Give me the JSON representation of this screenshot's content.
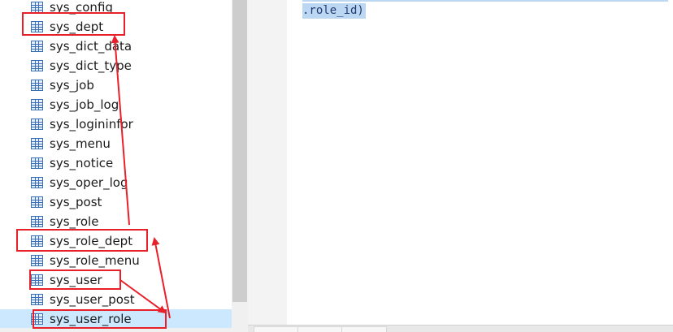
{
  "tables": [
    {
      "name": "sys_config"
    },
    {
      "name": "sys_dept"
    },
    {
      "name": "sys_dict_data"
    },
    {
      "name": "sys_dict_type"
    },
    {
      "name": "sys_job"
    },
    {
      "name": "sys_job_log"
    },
    {
      "name": "sys_logininfor"
    },
    {
      "name": "sys_menu"
    },
    {
      "name": "sys_notice"
    },
    {
      "name": "sys_oper_log"
    },
    {
      "name": "sys_post"
    },
    {
      "name": "sys_role"
    },
    {
      "name": "sys_role_dept"
    },
    {
      "name": "sys_role_menu"
    },
    {
      "name": "sys_user"
    },
    {
      "name": "sys_user_post"
    },
    {
      "name": "sys_user_role"
    }
  ],
  "selected_table": "sys_user_role",
  "highlighted_tables": [
    "sys_dept",
    "sys_role_dept",
    "sys_user",
    "sys_user_role"
  ],
  "editor": {
    "code_line": ".role_id)"
  },
  "colors": {
    "annotation": "#e8202a",
    "selection": "#cce8ff",
    "code_highlight": "#bcd7f1"
  }
}
